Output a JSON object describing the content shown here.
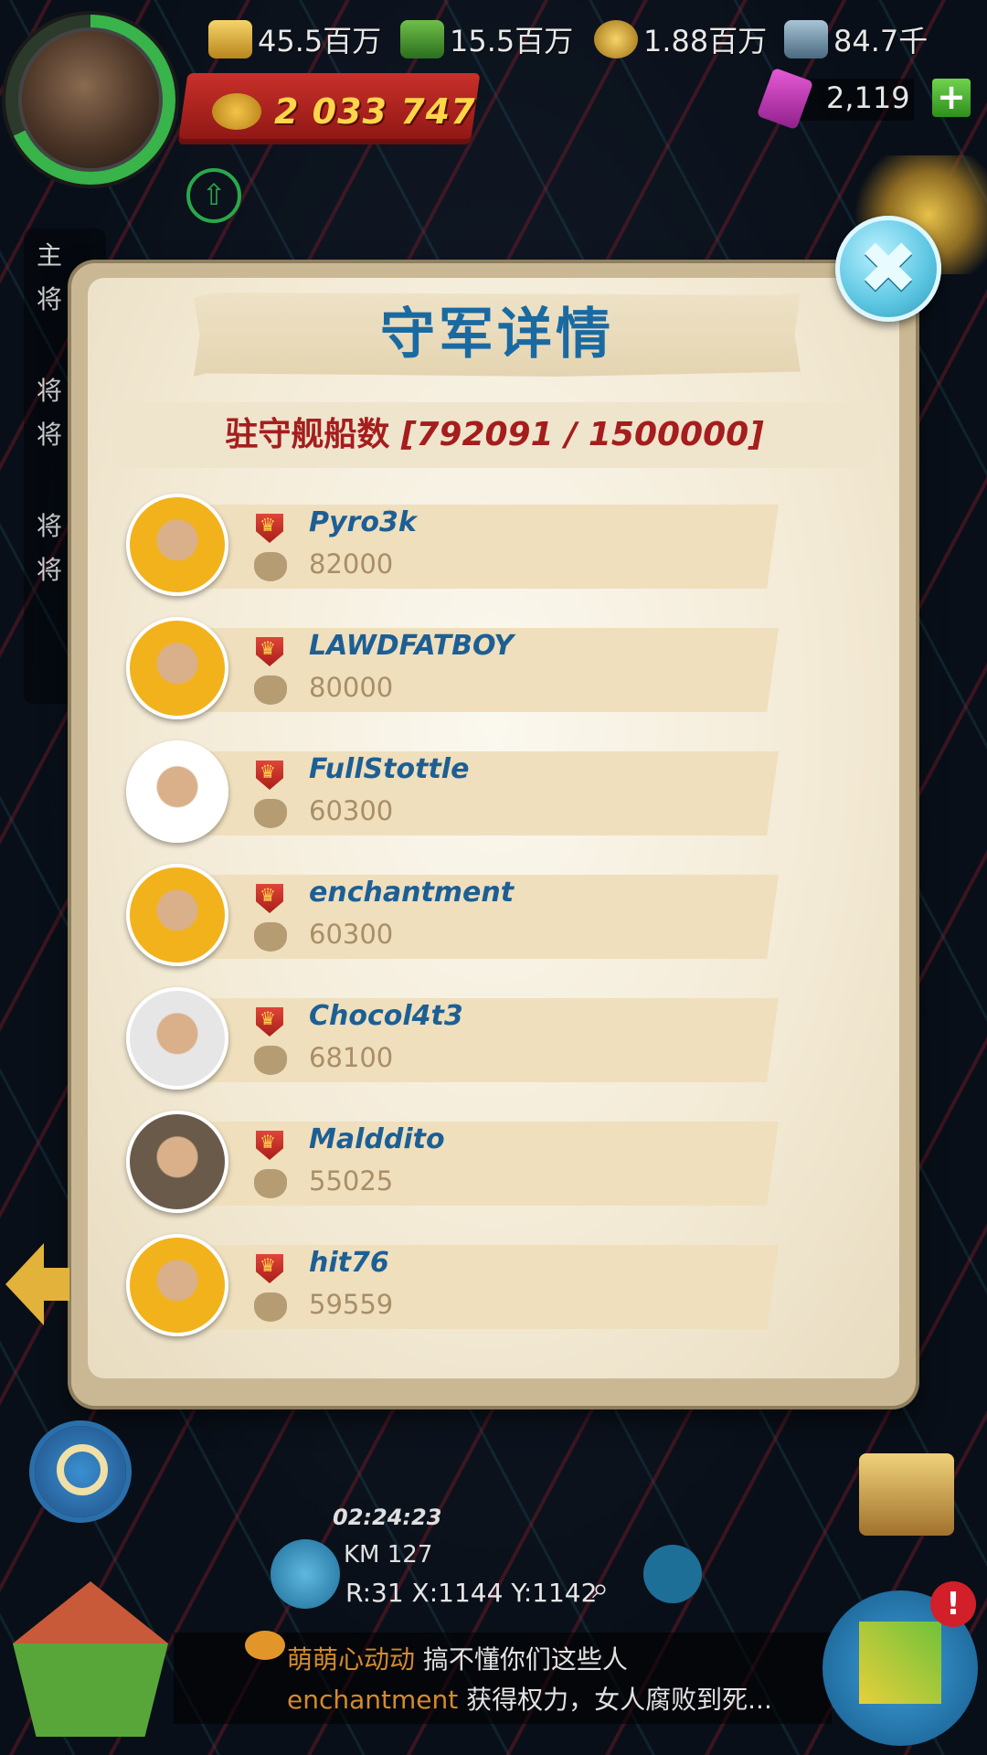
{
  "hud": {
    "power": "2 033 747",
    "resources": [
      {
        "icon": "gold-bars-icon",
        "value": "45.5百万",
        "color": "#e6b93a"
      },
      {
        "icon": "oil-barrel-icon",
        "value": "15.5百万",
        "color": "#4a9a3a"
      },
      {
        "icon": "medal-icon",
        "value": "1.88百万",
        "color": "#e6b93a"
      },
      {
        "icon": "steel-icon",
        "value": "84.7千",
        "color": "#6a8fa6"
      }
    ],
    "gems": "2,119",
    "plus_label": "+"
  },
  "side_panel": {
    "items": [
      "主",
      "将",
      "将",
      "将",
      "将",
      "将"
    ]
  },
  "dialog": {
    "title": "守军详情",
    "count_label": "驻守舰船数",
    "count_value": "[792091 / 1500000]",
    "close_label": "✖",
    "defenders": [
      {
        "name": "Pyro3k",
        "amount": "82000",
        "avatar_color": "#f2b21c"
      },
      {
        "name": "LAWDFATBOY",
        "amount": "80000",
        "avatar_color": "#f2b21c"
      },
      {
        "name": "FullStottle",
        "amount": "60300",
        "avatar_color": "#ffffff"
      },
      {
        "name": "enchantment",
        "amount": "60300",
        "avatar_color": "#f2b21c"
      },
      {
        "name": "Chocol4t3",
        "amount": "68100",
        "avatar_color": "#e6e6e6"
      },
      {
        "name": "Malddito",
        "amount": "55025",
        "avatar_color": "#6a5a4a"
      },
      {
        "name": "hit76",
        "amount": "59559",
        "avatar_color": "#f2b21c"
      }
    ]
  },
  "bottom": {
    "timer": "02:24:23",
    "km": "KM 127",
    "coords": "R:31 X:1144 Y:1142",
    "chat": [
      {
        "who": "萌萌心动动",
        "msg": "搞不懂你们这些人"
      },
      {
        "who": "enchantment",
        "msg": "获得权力，女人腐败到死..."
      }
    ],
    "alert": "!"
  }
}
